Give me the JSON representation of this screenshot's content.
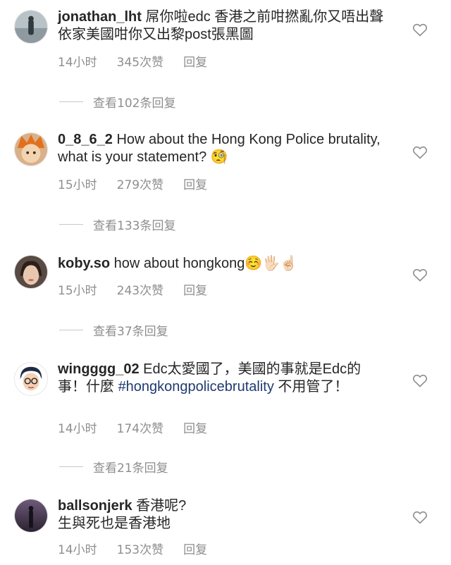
{
  "comments": [
    {
      "username": "jonathan_lht",
      "text": "屌你啦edc 香港之前咁撚亂你又唔出聲 依家美國咁你又出黎post張黑圖",
      "time": "14小时",
      "likes": "345次赞",
      "reply": "回复",
      "view_replies": "查看102条回复",
      "avatar": "person-by-sea-avatar"
    },
    {
      "username": "0_8_6_2",
      "text": "How about the Hong Kong Police brutality, what is your statement?",
      "emoji": "🧐",
      "time": "15小时",
      "likes": "279次赞",
      "reply": "回复",
      "view_replies": "查看133条回复",
      "avatar": "orange-hair-anime-avatar"
    },
    {
      "username": "koby.so",
      "text": "how about hongkong",
      "emoji": "☺️🖐🏻☝🏻",
      "time": "15小时",
      "likes": "243次赞",
      "reply": "回复",
      "view_replies": "查看37条回复",
      "avatar": "woman-portrait-avatar"
    },
    {
      "username": "wingggg_02",
      "text_before": "Edc太愛國了，美國的事就是Edc的事！什麼",
      "hashtag": "#hongkongpolicebrutality",
      "text_after": " 不用管了！",
      "time": "14小时",
      "likes": "174次赞",
      "reply": "回复",
      "view_replies": "查看21条回复",
      "avatar": "cartoon-face-avatar"
    },
    {
      "username": "ballsonjerk",
      "text": "香港呢?",
      "text_line2": "生與死也是香港地",
      "time": "14小时",
      "likes": "153次赞",
      "reply": "回复",
      "avatar": "dark-figure-avatar"
    }
  ]
}
